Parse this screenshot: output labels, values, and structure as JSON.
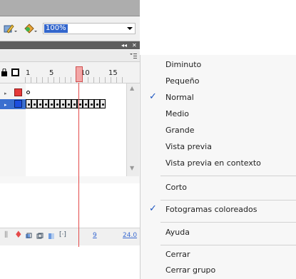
{
  "toolbar": {
    "zoom_value": "100%"
  },
  "timeline": {
    "ruler": [
      "1",
      "5",
      "10",
      "15"
    ],
    "frame_number": "9",
    "frame_rate": "24.0"
  },
  "menu": {
    "items": [
      {
        "label": "Diminuto",
        "checked": false
      },
      {
        "label": "Pequeño",
        "checked": false
      },
      {
        "label": "Normal",
        "checked": true
      },
      {
        "label": "Medio",
        "checked": false
      },
      {
        "label": "Grande",
        "checked": false
      },
      {
        "label": "Vista previa",
        "checked": false
      },
      {
        "label": "Vista previa en contexto",
        "checked": false
      },
      {
        "label": "Corto",
        "checked": false
      },
      {
        "label": "Fotogramas coloreados",
        "checked": true
      },
      {
        "label": "Ayuda",
        "checked": false
      },
      {
        "label": "Cerrar",
        "checked": false
      },
      {
        "label": "Cerrar grupo",
        "checked": false
      }
    ],
    "check_glyph": "✓"
  },
  "colors": {
    "layer_red": "#e53a3a",
    "layer_blue": "#1d4fe0",
    "selection": "#3a6fcf",
    "playhead": "#e34a4a"
  },
  "icons": [
    "pencil-icon",
    "paint-bucket-icon",
    "dropdown-arrow-icon",
    "collapse-icon",
    "close-icon",
    "panel-menu-icon",
    "outline-square-icon",
    "trash-icon",
    "onion-skin-icon",
    "edit-frames-icon"
  ]
}
